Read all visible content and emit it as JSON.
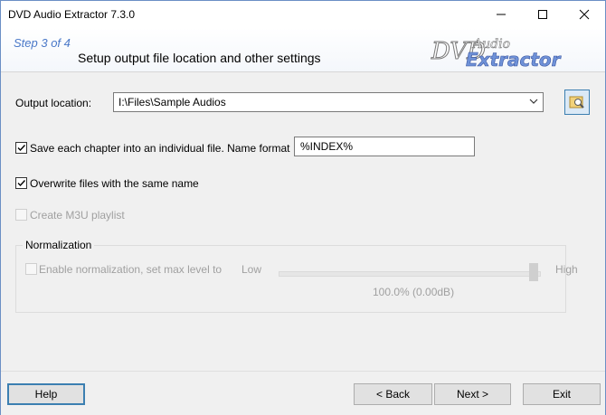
{
  "window": {
    "title": "DVD Audio Extractor 7.3.0"
  },
  "header": {
    "step": "Step 3 of 4",
    "subtitle": "Setup output file location and other settings",
    "logo_top": "DVD Audio",
    "logo_bottom": "Extractor"
  },
  "output": {
    "label": "Output location:",
    "value": "I:\\Files\\Sample Audios"
  },
  "chapters": {
    "label": "Save each chapter into an individual file. Name format",
    "checked": true,
    "format": "%INDEX%"
  },
  "overwrite": {
    "label": "Overwrite files with the same name",
    "checked": true
  },
  "m3u": {
    "label": "Create M3U playlist",
    "checked": false,
    "enabled": false
  },
  "normalization": {
    "group_title": "Normalization",
    "label": "Enable normalization, set max level to",
    "low": "Low",
    "high": "High",
    "value_text": "100.0% (0.00dB)",
    "level": 1.0
  },
  "buttons": {
    "help": "Help",
    "back": "< Back",
    "next": "Next >",
    "exit": "Exit"
  },
  "colors": {
    "accent": "#3c7fb1",
    "step": "#4a78c8"
  }
}
